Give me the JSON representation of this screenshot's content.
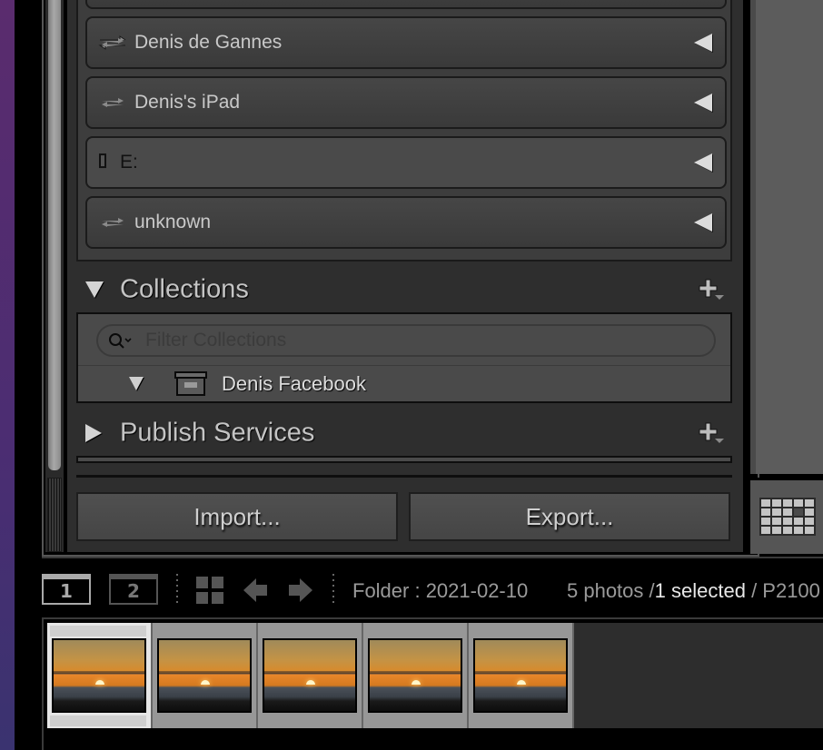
{
  "devices_panel": {
    "items": [
      {
        "label": "Denis de Gannes",
        "icon": "sync-arrows-icon"
      },
      {
        "label": "Denis's iPad",
        "icon": "sync-arrows-icon"
      },
      {
        "label": "E:",
        "icon": "drive-icon"
      },
      {
        "label": "unknown",
        "icon": "sync-arrows-icon"
      }
    ]
  },
  "collections": {
    "title": "Collections",
    "expanded": true,
    "filter_placeholder": "Filter Collections",
    "filter_value": "",
    "items": [
      {
        "label": "Denis Facebook",
        "type": "collection-set",
        "expanded": true
      }
    ]
  },
  "publish_services": {
    "title": "Publish Services",
    "expanded": false
  },
  "buttons": {
    "import": "Import...",
    "export": "Export..."
  },
  "toolbar": {
    "screen1": "1",
    "screen2": "2",
    "folder_text": "Folder : 2021-02-10",
    "count_text": "5 photos /",
    "selected_text": "1 selected",
    "filename_text": "/ P2100"
  },
  "filmstrip": {
    "photos": [
      {
        "selected": true
      },
      {
        "selected": false
      },
      {
        "selected": false
      },
      {
        "selected": false
      },
      {
        "selected": false
      }
    ]
  }
}
